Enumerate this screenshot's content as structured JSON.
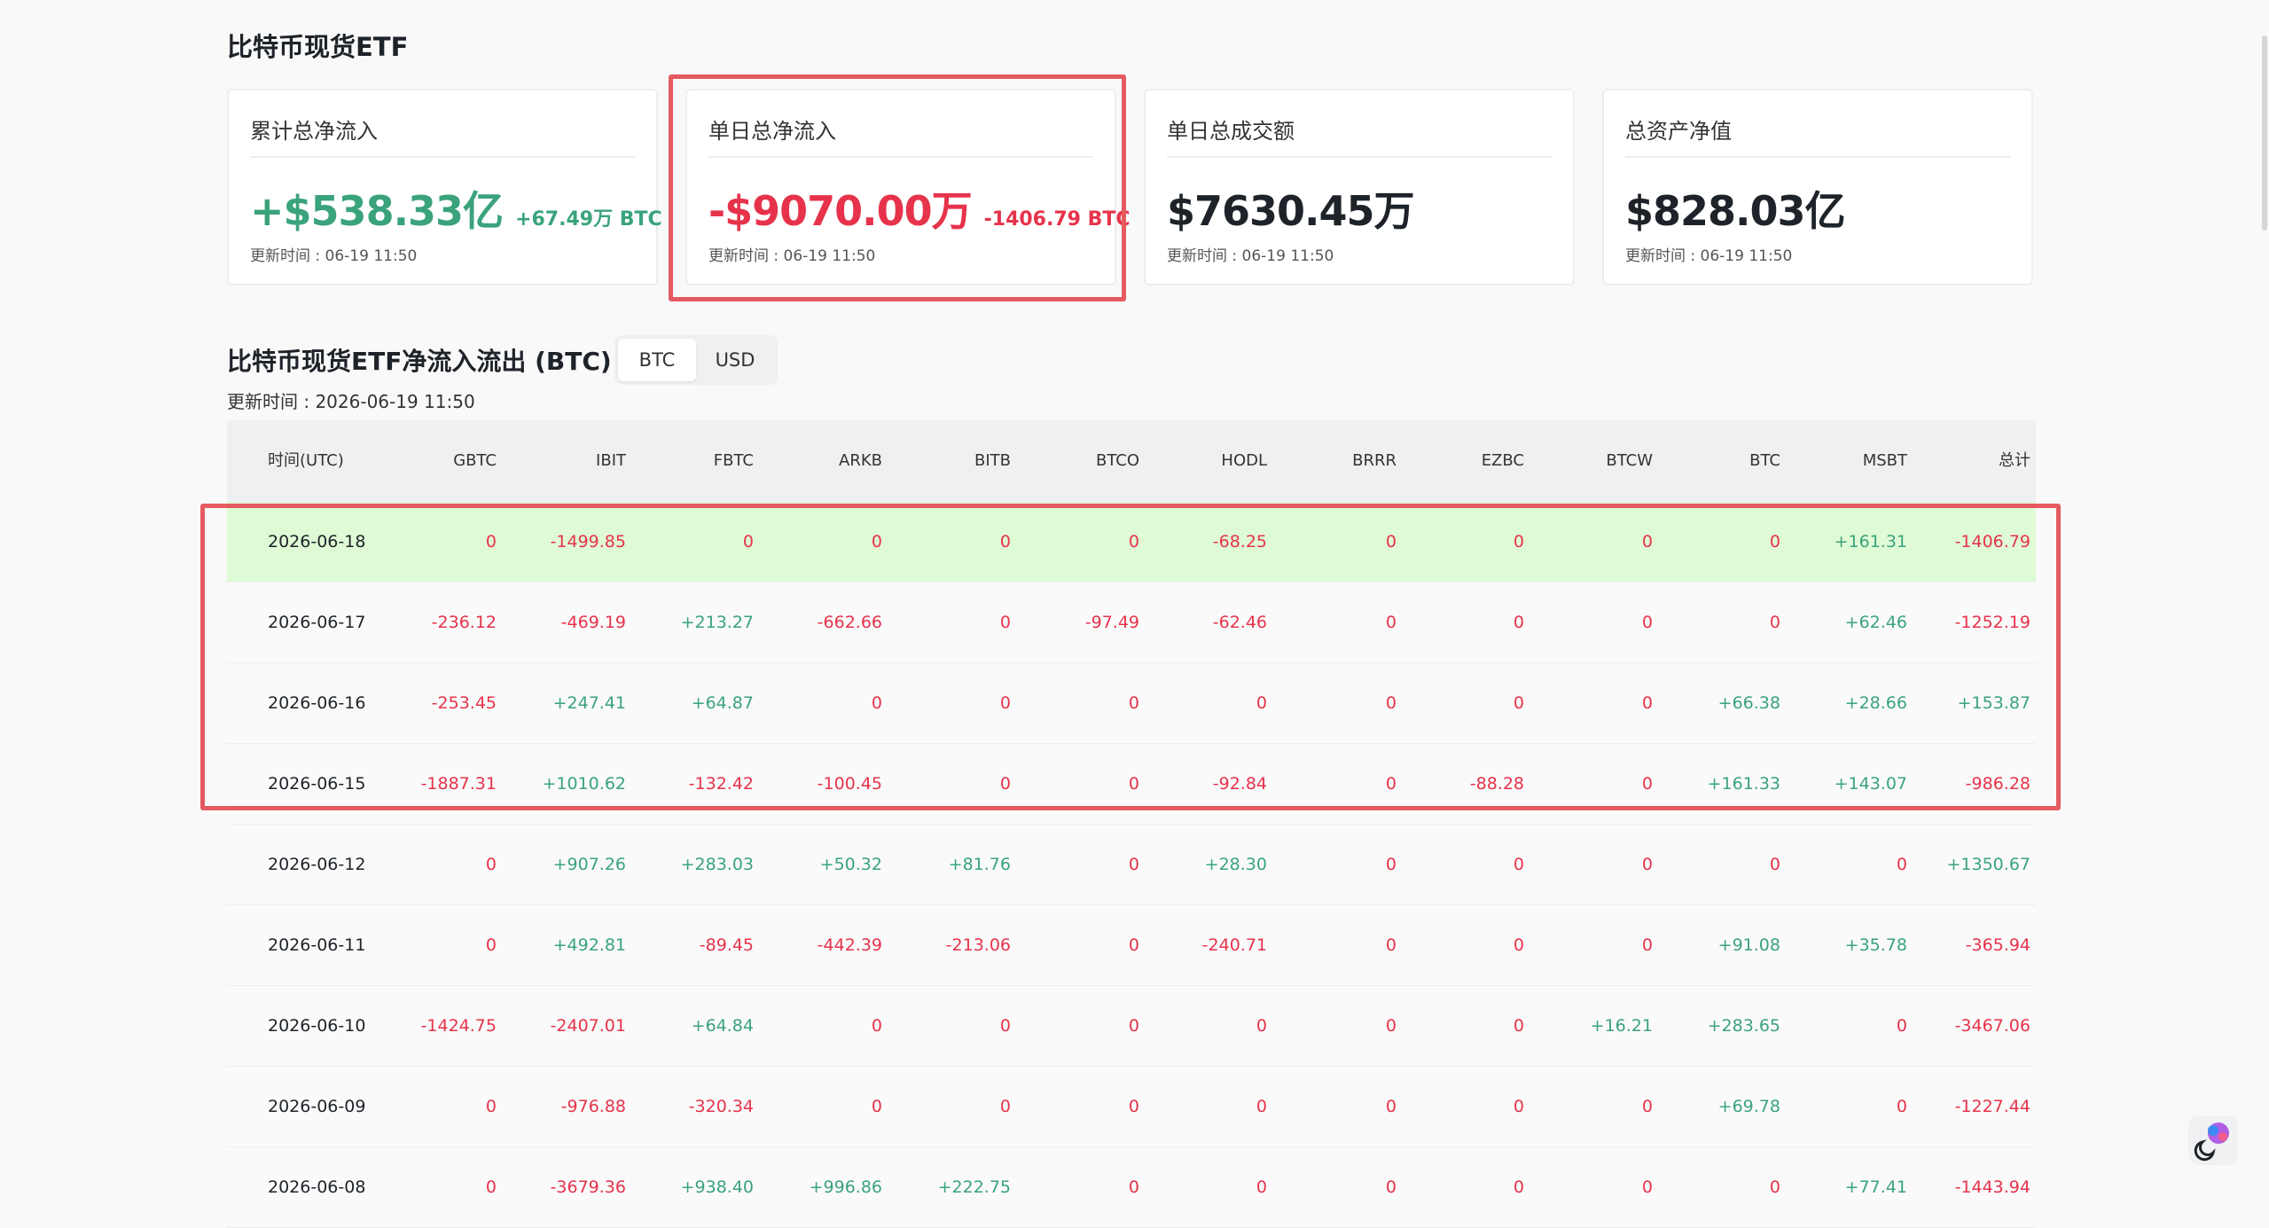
{
  "page_title": "比特币现货ETF",
  "cards": [
    {
      "label": "累计总净流入",
      "value": "+$538.33亿",
      "sub": "+67.49万 BTC",
      "time": "更新时间 : 06-19 11:50",
      "tone": "pos"
    },
    {
      "label": "单日总净流入",
      "value": "-$9070.00万",
      "sub": "-1406.79 BTC",
      "time": "更新时间 : 06-19 11:50",
      "tone": "neg"
    },
    {
      "label": "单日总成交额",
      "value": "$7630.45万",
      "sub": "",
      "time": "更新时间 : 06-19 11:50",
      "tone": "dark"
    },
    {
      "label": "总资产净值",
      "value": "$828.03亿",
      "sub": "",
      "time": "更新时间 : 06-19 11:50",
      "tone": "dark"
    }
  ],
  "section": {
    "title": "比特币现货ETF净流入流出 (BTC)",
    "toggle": {
      "btc": "BTC",
      "usd": "USD",
      "active": "BTC"
    },
    "update_time": "更新时间 : 2026-06-19 11:50"
  },
  "table": {
    "columns": [
      "时间(UTC)",
      "GBTC",
      "IBIT",
      "FBTC",
      "ARKB",
      "BITB",
      "BTCO",
      "HODL",
      "BRRR",
      "EZBC",
      "BTCW",
      "BTC",
      "MSBT",
      "总计"
    ],
    "rows": [
      [
        "2026-06-18",
        "0",
        "-1499.85",
        "0",
        "0",
        "0",
        "0",
        "-68.25",
        "0",
        "0",
        "0",
        "0",
        "+161.31",
        "-1406.79"
      ],
      [
        "2026-06-17",
        "-236.12",
        "-469.19",
        "+213.27",
        "-662.66",
        "0",
        "-97.49",
        "-62.46",
        "0",
        "0",
        "0",
        "0",
        "+62.46",
        "-1252.19"
      ],
      [
        "2026-06-16",
        "-253.45",
        "+247.41",
        "+64.87",
        "0",
        "0",
        "0",
        "0",
        "0",
        "0",
        "0",
        "+66.38",
        "+28.66",
        "+153.87"
      ],
      [
        "2026-06-15",
        "-1887.31",
        "+1010.62",
        "-132.42",
        "-100.45",
        "0",
        "0",
        "-92.84",
        "0",
        "-88.28",
        "0",
        "+161.33",
        "+143.07",
        "-986.28"
      ],
      [
        "2026-06-12",
        "0",
        "+907.26",
        "+283.03",
        "+50.32",
        "+81.76",
        "0",
        "+28.30",
        "0",
        "0",
        "0",
        "0",
        "0",
        "+1350.67"
      ],
      [
        "2026-06-11",
        "0",
        "+492.81",
        "-89.45",
        "-442.39",
        "-213.06",
        "0",
        "-240.71",
        "0",
        "0",
        "0",
        "+91.08",
        "+35.78",
        "-365.94"
      ],
      [
        "2026-06-10",
        "-1424.75",
        "-2407.01",
        "+64.84",
        "0",
        "0",
        "0",
        "0",
        "0",
        "0",
        "+16.21",
        "+283.65",
        "0",
        "-3467.06"
      ],
      [
        "2026-06-09",
        "0",
        "-976.88",
        "-320.34",
        "0",
        "0",
        "0",
        "0",
        "0",
        "0",
        "0",
        "+69.78",
        "0",
        "-1227.44"
      ],
      [
        "2026-06-08",
        "0",
        "-3679.36",
        "+938.40",
        "+996.86",
        "+222.75",
        "0",
        "0",
        "0",
        "0",
        "0",
        "0",
        "+77.41",
        "-1443.94"
      ]
    ]
  },
  "colors": {
    "positive": "#3aa37c",
    "negative": "#e6334b",
    "highlight": "#e55a5f",
    "row_highlight": "#dffbd6"
  },
  "icons": {
    "floating_button": "brain-icon",
    "theme_toggle": "moon-icon"
  }
}
